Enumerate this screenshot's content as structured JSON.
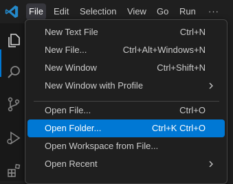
{
  "menubar": {
    "items": [
      {
        "label": "File"
      },
      {
        "label": "Edit"
      },
      {
        "label": "Selection"
      },
      {
        "label": "View"
      },
      {
        "label": "Go"
      },
      {
        "label": "Run"
      },
      {
        "label": "···"
      }
    ]
  },
  "menu": {
    "groups": [
      [
        {
          "label": "New Text File",
          "shortcut": "Ctrl+N"
        },
        {
          "label": "New File...",
          "shortcut": "Ctrl+Alt+Windows+N"
        },
        {
          "label": "New Window",
          "shortcut": "Ctrl+Shift+N"
        },
        {
          "label": "New Window with Profile",
          "shortcut": "",
          "submenu": true
        }
      ],
      [
        {
          "label": "Open File...",
          "shortcut": "Ctrl+O"
        },
        {
          "label": "Open Folder...",
          "shortcut": "Ctrl+K Ctrl+O",
          "selected": true
        },
        {
          "label": "Open Workspace from File...",
          "shortcut": ""
        },
        {
          "label": "Open Recent",
          "shortcut": "",
          "submenu": true
        }
      ]
    ]
  },
  "colors": {
    "accent": "#0078d4",
    "menu_bg": "#1f1f1f",
    "activitybar_bg": "#181818",
    "vscode_logo": "#2489ca"
  },
  "icons": [
    "vscode-logo-icon",
    "explorer-icon",
    "search-icon",
    "source-control-icon",
    "run-debug-icon",
    "extensions-icon",
    "chevron-right-icon"
  ]
}
